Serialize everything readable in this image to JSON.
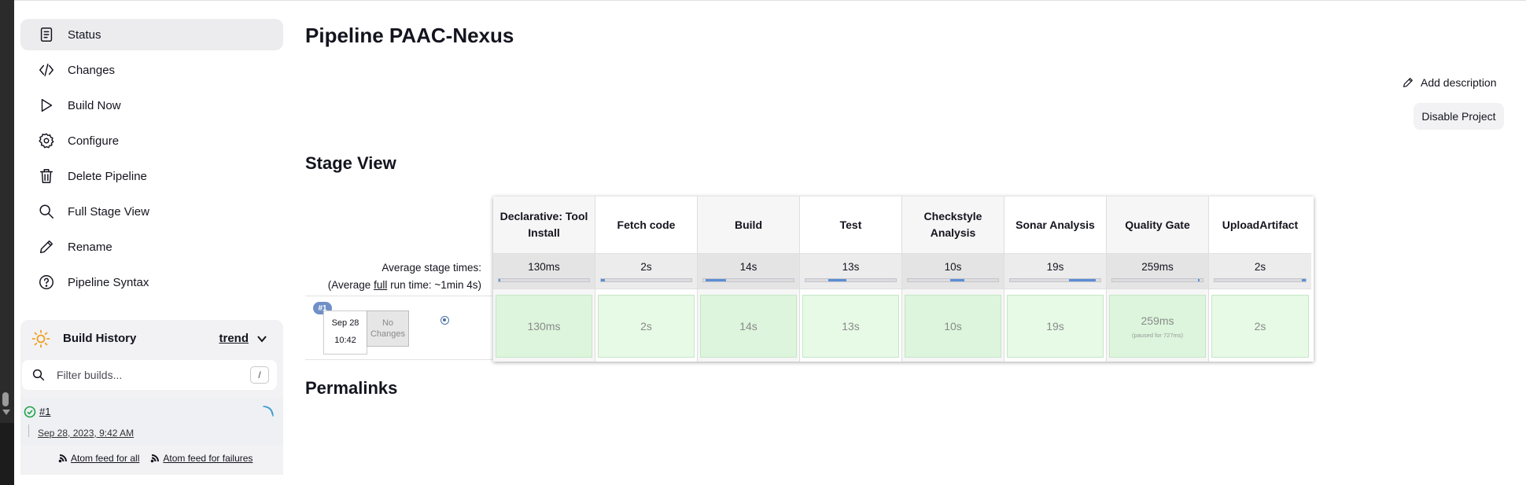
{
  "sidebar": {
    "tasks": [
      {
        "label": "Status",
        "icon": "document-icon",
        "active": true
      },
      {
        "label": "Changes",
        "icon": "code-icon"
      },
      {
        "label": "Build Now",
        "icon": "play-icon"
      },
      {
        "label": "Configure",
        "icon": "gear-icon"
      },
      {
        "label": "Delete Pipeline",
        "icon": "trash-icon"
      },
      {
        "label": "Full Stage View",
        "icon": "search-icon"
      },
      {
        "label": "Rename",
        "icon": "pencil-icon"
      },
      {
        "label": "Pipeline Syntax",
        "icon": "help-icon"
      }
    ]
  },
  "build_history": {
    "title": "Build History",
    "trend": "trend",
    "filter_placeholder": "Filter builds...",
    "filter_shortcut": "/",
    "builds": [
      {
        "number": "#1",
        "date": "Sep 28, 2023, 9:42 AM",
        "status": "success"
      }
    ],
    "feeds": {
      "all": "Atom feed for all",
      "failures": "Atom feed for failures"
    }
  },
  "main": {
    "title": "Pipeline PAAC-Nexus",
    "add_description": "Add description",
    "disable_project": "Disable Project",
    "stage_view_heading": "Stage View",
    "permalinks_heading": "Permalinks"
  },
  "stage_view": {
    "avg_label_line1": "Average stage times:",
    "avg_label_prefix": "(Average ",
    "avg_label_full": "full",
    "avg_label_suffix": " run time: ~1min 4s)",
    "run": {
      "badge": "#1",
      "date": "Sep 28",
      "time": "10:42",
      "changes": "No Changes"
    },
    "stages": [
      {
        "name": "Declarative: Tool Install",
        "avg": "130ms",
        "run": "130ms",
        "bar_start": 0.0,
        "bar_width": 0.02
      },
      {
        "name": "Fetch code",
        "avg": "2s",
        "run": "2s",
        "bar_start": 0.0,
        "bar_width": 0.04
      },
      {
        "name": "Build",
        "avg": "14s",
        "run": "14s",
        "bar_start": 0.03,
        "bar_width": 0.22
      },
      {
        "name": "Test",
        "avg": "13s",
        "run": "13s",
        "bar_start": 0.25,
        "bar_width": 0.2
      },
      {
        "name": "Checkstyle Analysis",
        "avg": "10s",
        "run": "10s",
        "bar_start": 0.47,
        "bar_width": 0.16
      },
      {
        "name": "Sonar Analysis",
        "avg": "19s",
        "run": "19s",
        "bar_start": 0.65,
        "bar_width": 0.3
      },
      {
        "name": "Quality Gate",
        "avg": "259ms",
        "run": "259ms",
        "run_note": "(paused for 727ms)",
        "bar_start": 0.95,
        "bar_width": 0.01
      },
      {
        "name": "UploadArtifact",
        "avg": "2s",
        "run": "2s",
        "bar_start": 0.96,
        "bar_width": 0.04
      }
    ]
  },
  "colors": {
    "accent": "#5b8ed6",
    "success_cell": "#e6fae6",
    "badge": "#6f8fc7"
  }
}
